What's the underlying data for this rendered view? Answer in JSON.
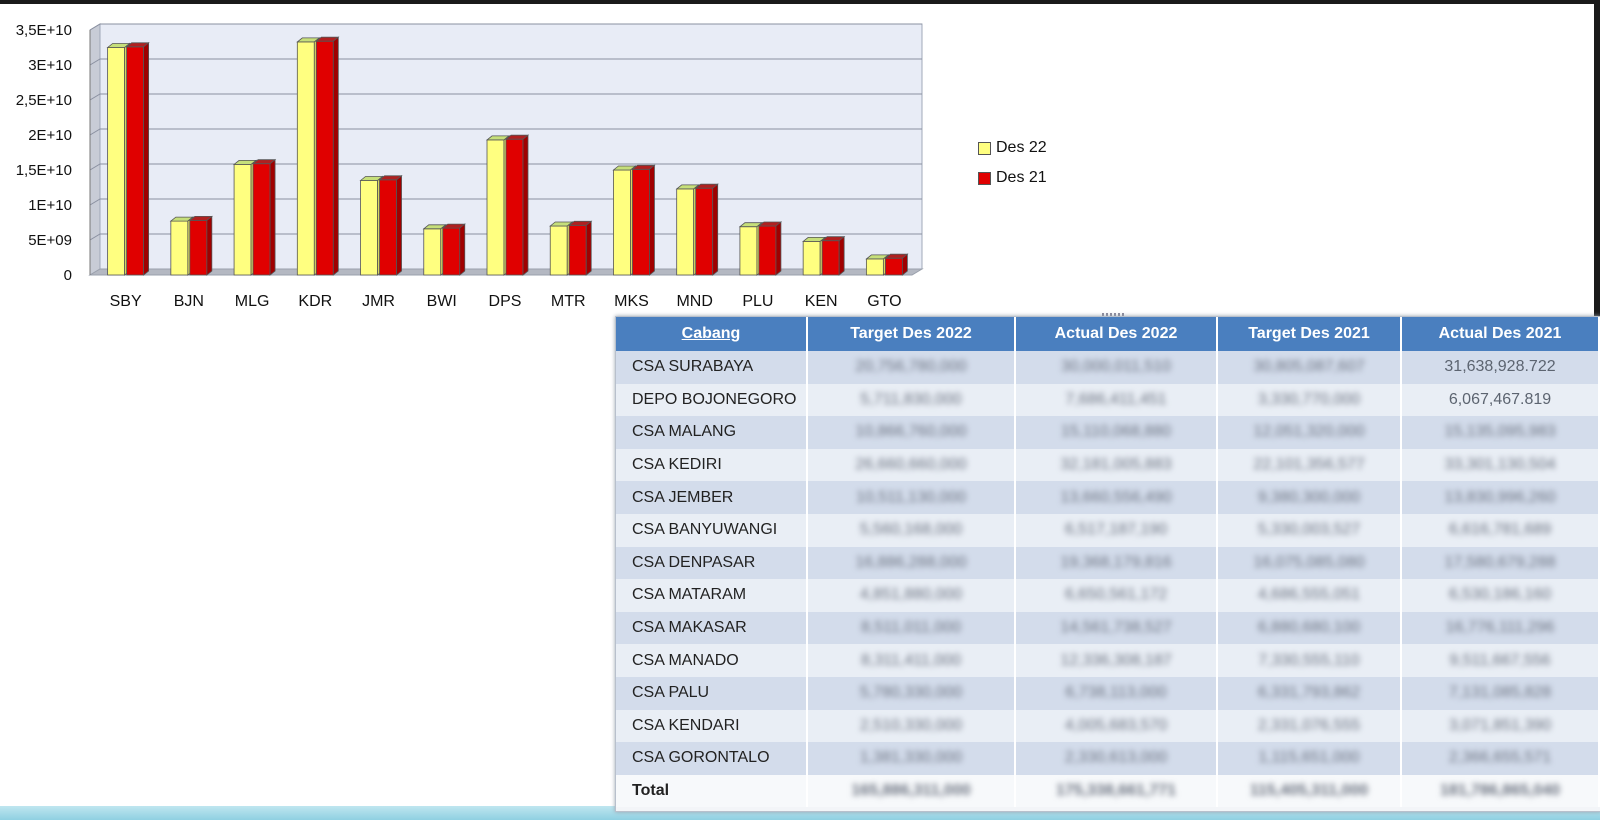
{
  "chart_data": {
    "type": "bar",
    "categories": [
      "SBY",
      "BJN",
      "MLG",
      "KDR",
      "JMR",
      "BWI",
      "DPS",
      "MTR",
      "MKS",
      "MND",
      "PLU",
      "KEN",
      "GTO"
    ],
    "series": [
      {
        "name": "Des 22",
        "color": "#ffff80",
        "values": [
          32500000000,
          7700000000,
          15800000000,
          33300000000,
          13500000000,
          6600000000,
          19300000000,
          7000000000,
          15000000000,
          12300000000,
          6900000000,
          4800000000,
          2300000000
        ]
      },
      {
        "name": "Des 21",
        "color": "#e00000",
        "values": [
          32600000000,
          7800000000,
          15900000000,
          33400000000,
          13600000000,
          6700000000,
          19400000000,
          7100000000,
          15100000000,
          12400000000,
          7000000000,
          4900000000,
          2400000000
        ]
      }
    ],
    "yticks": [
      "0",
      "5E+09",
      "1E+10",
      "1,5E+10",
      "2E+10",
      "2,5E+10",
      "3E+10",
      "3,5E+10"
    ],
    "ylim": [
      0,
      35000000000
    ],
    "legend_position": "right",
    "grid": true
  },
  "table": {
    "headers": [
      "Cabang",
      "Target Des 2022",
      "Actual Des 2022",
      "Target Des 2021",
      "Actual Des 2021"
    ],
    "rows": [
      {
        "name": "CSA SURABAYA",
        "cells": [
          "20,756,780,000",
          "30,000,011,510",
          "30,805,087,607",
          "31,638,928.722"
        ],
        "clear": [
          false,
          false,
          false,
          true
        ]
      },
      {
        "name": "DEPO BOJONEGORO",
        "cells": [
          "5,711,830,000",
          "7,686,411,451",
          "3,330,770,000",
          "6,067,467.819"
        ],
        "clear": [
          false,
          false,
          false,
          true
        ]
      },
      {
        "name": "CSA MALANG",
        "cells": [
          "10,866,760,000",
          "15,110,068,880",
          "12,051,320,000",
          "15,135,095,983"
        ],
        "clear": [
          false,
          false,
          false,
          false
        ]
      },
      {
        "name": "CSA KEDIRI",
        "cells": [
          "26,660,660,000",
          "32,181,005,883",
          "22,101,356,577",
          "33,301,130,504"
        ],
        "clear": [
          false,
          false,
          false,
          false
        ]
      },
      {
        "name": "CSA JEMBER",
        "cells": [
          "10,511,130,000",
          "13,660,556,490",
          "9,380,300,000",
          "13,830,996,260"
        ],
        "clear": [
          false,
          false,
          false,
          false
        ]
      },
      {
        "name": "CSA BANYUWANGI",
        "cells": [
          "5,560,168,000",
          "6,517,187,190",
          "5,330,003,527",
          "6,616,781,689"
        ],
        "clear": [
          false,
          false,
          false,
          false
        ]
      },
      {
        "name": "CSA DENPASAR",
        "cells": [
          "16,886,288,000",
          "19,368,179,816",
          "16,075,085,080",
          "17,580,679,288"
        ],
        "clear": [
          false,
          false,
          false,
          false
        ]
      },
      {
        "name": "CSA MATARAM",
        "cells": [
          "4,851,880,000",
          "6,650,561,172",
          "4,686,555,051",
          "6,530,186,160"
        ],
        "clear": [
          false,
          false,
          false,
          false
        ]
      },
      {
        "name": "CSA MAKASAR",
        "cells": [
          "8,511,011,000",
          "14,561,738,527",
          "6,880,680,100",
          "16,776,111,296"
        ],
        "clear": [
          false,
          false,
          false,
          false
        ]
      },
      {
        "name": "CSA MANADO",
        "cells": [
          "8,311,411,000",
          "12,336,308,187",
          "7,330,555,110",
          "9,511,667,556"
        ],
        "clear": [
          false,
          false,
          false,
          false
        ]
      },
      {
        "name": "CSA PALU",
        "cells": [
          "5,780,330,000",
          "6,738,113,000",
          "6,331,793,862",
          "7,131,085,828"
        ],
        "clear": [
          false,
          false,
          false,
          false
        ]
      },
      {
        "name": "CSA KENDARI",
        "cells": [
          "2,510,330,000",
          "4,005,683,570",
          "2,331,076,555",
          "3,071,851,390"
        ],
        "clear": [
          false,
          false,
          false,
          false
        ]
      },
      {
        "name": "CSA GORONTALO",
        "cells": [
          "1,381,330,000",
          "2,330,613,000",
          "1,115,651,000",
          "2,366,655,571"
        ],
        "clear": [
          false,
          false,
          false,
          false
        ]
      }
    ],
    "total": {
      "label": "Total",
      "cells": [
        "165,886,311,000",
        "175,338,661,771",
        "115,405,311,000",
        "181,786,865,040"
      ]
    }
  }
}
